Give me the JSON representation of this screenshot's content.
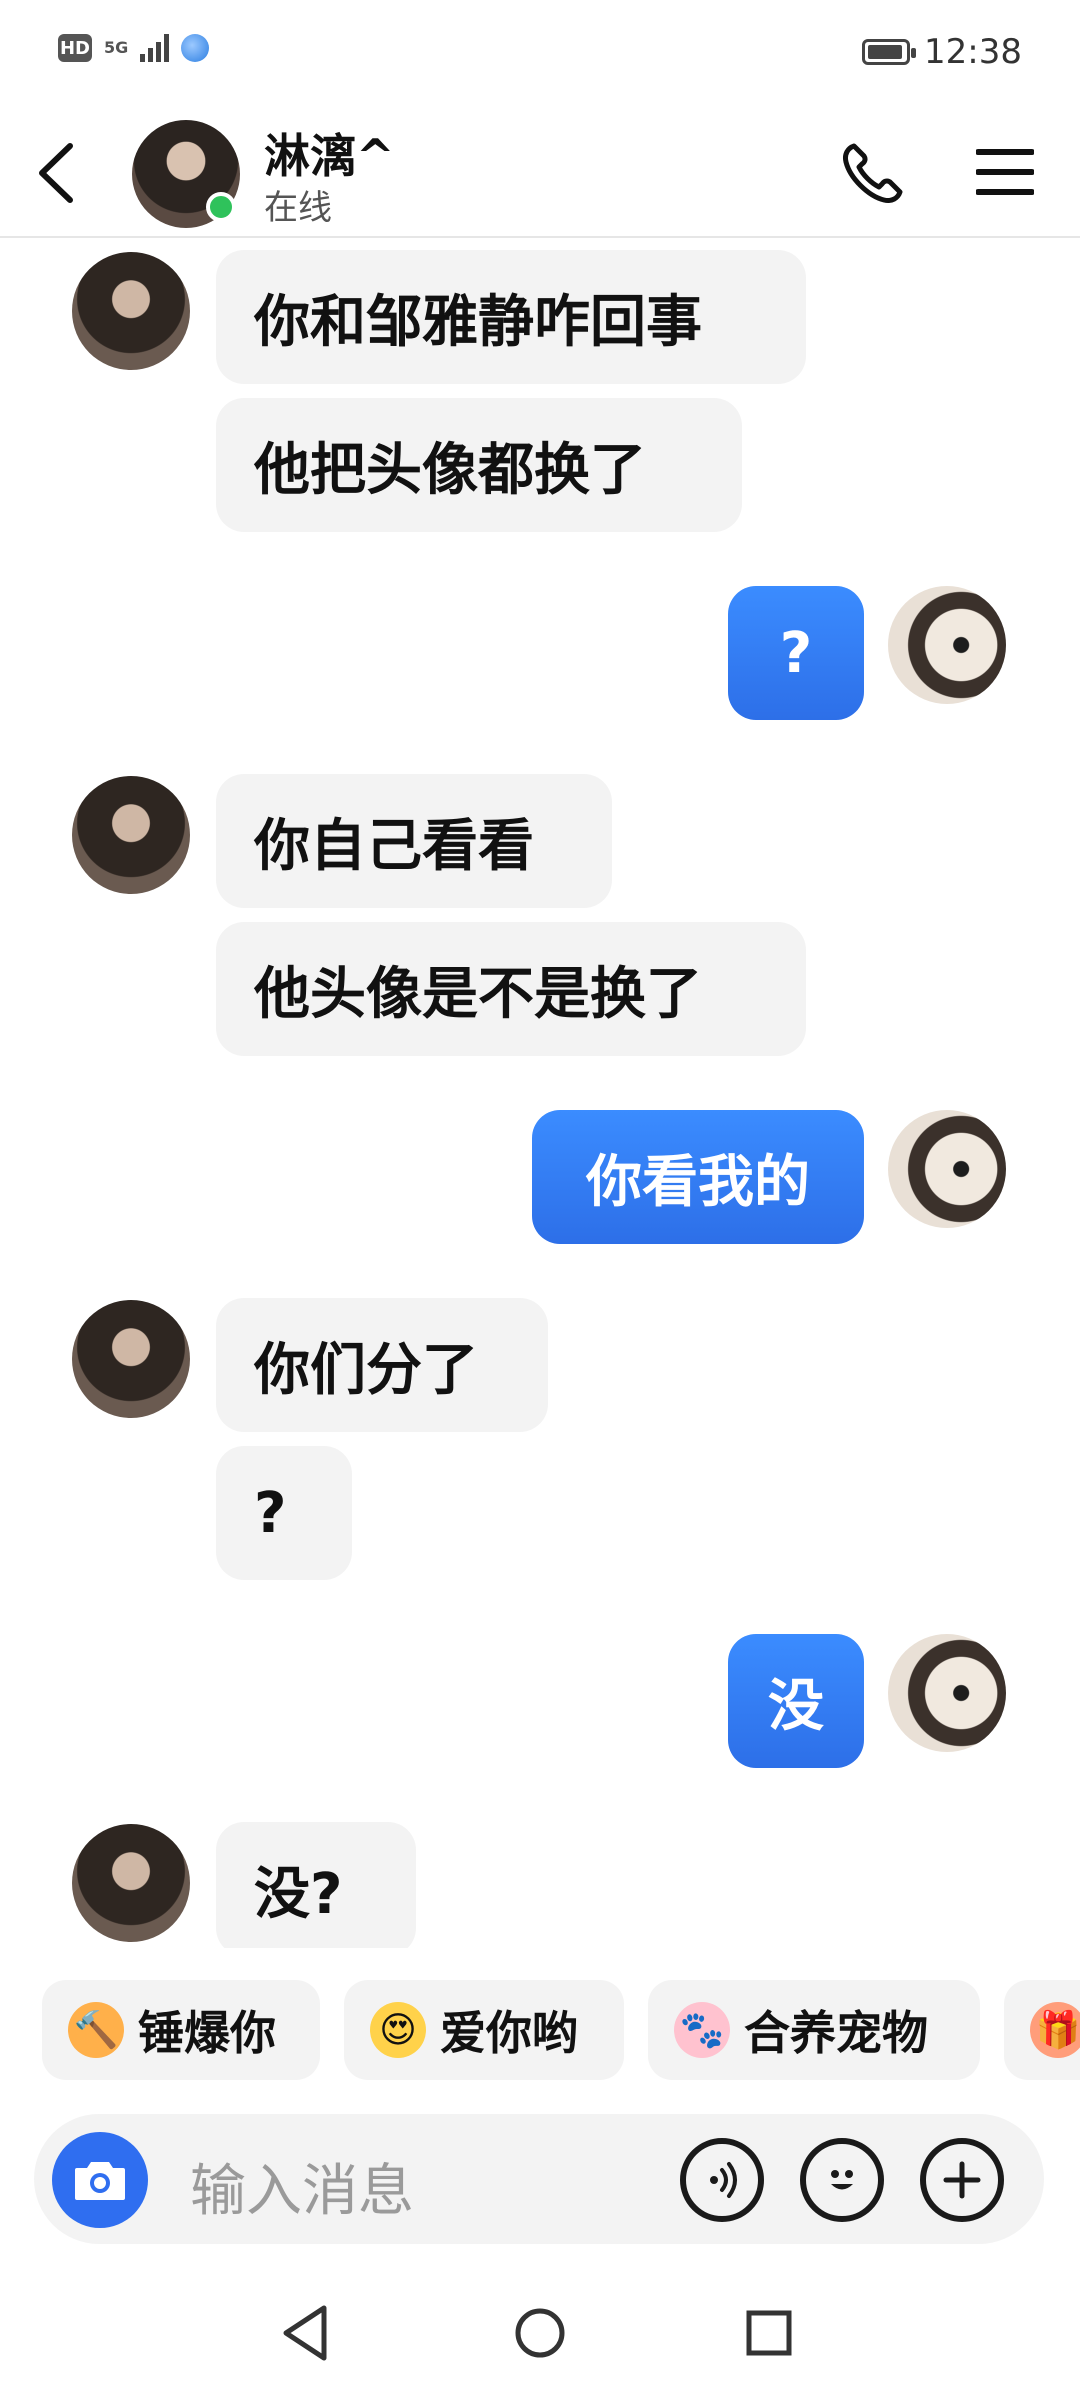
{
  "status_bar": {
    "hd": "HD",
    "network": "5G",
    "time": "12:38"
  },
  "header": {
    "name": "淋漓^",
    "status": "在线"
  },
  "messages": [
    {
      "side": "in",
      "text": "你和邹雅静咋回事"
    },
    {
      "side": "in",
      "text": "他把头像都换了"
    },
    {
      "side": "out",
      "text": "?"
    },
    {
      "side": "in",
      "text": "你自己看看"
    },
    {
      "side": "in",
      "text": "他头像是不是换了"
    },
    {
      "side": "out",
      "text": "你看我的"
    },
    {
      "side": "in",
      "text": "你们分了"
    },
    {
      "side": "in",
      "text": "?"
    },
    {
      "side": "out",
      "text": "没"
    },
    {
      "side": "in",
      "text": "没?"
    }
  ],
  "quick_replies": [
    {
      "label": "锤爆你",
      "icon": "hammer-emoji-icon",
      "color": "#ff8a1f"
    },
    {
      "label": "爱你哟",
      "icon": "heart-eyes-emoji-icon",
      "color": "#ffcc33"
    },
    {
      "label": "合养宠物",
      "icon": "pet-emoji-icon",
      "color": "#ff9db1"
    }
  ],
  "input": {
    "placeholder": "输入消息"
  },
  "colors": {
    "accent": "#2f6ef0",
    "online": "#2fc25b",
    "bubble_in": "#f3f3f3"
  }
}
